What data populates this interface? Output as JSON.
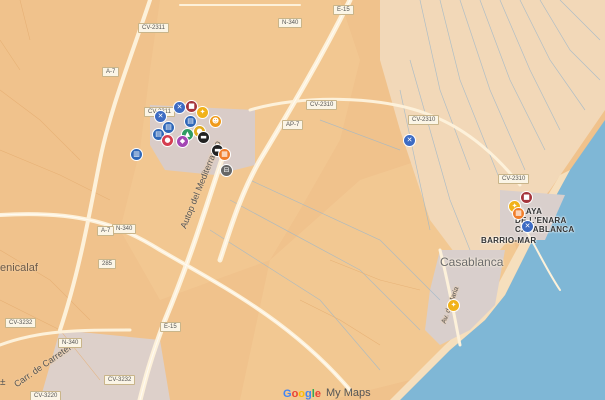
{
  "places": {
    "benicalaf": "enicalaf",
    "casablanca": "Casablanca",
    "barrio_mar": "BARRIO-MAR",
    "playa_lenara_1": "PLAYA",
    "playa_lenara_2": "DE L'ENARA",
    "casablanca_caps": "CASABLANCA"
  },
  "roads": {
    "autopista": "Autop del Mediterraneo",
    "carretera": "Carr. de Carretera",
    "avenida": "Av. de Maria"
  },
  "shields": [
    "CV-2311",
    "N-340",
    "E-15",
    "A-7",
    "CV-2311",
    "AP-7",
    "CV-2310",
    "CV-2310",
    "CV-2310",
    "N-340",
    "A-7",
    "285",
    "E-15",
    "CV-3232",
    "CV-3232",
    "N-340",
    "CV-3220"
  ],
  "markers": [
    {
      "type": "restaurant-icon",
      "color": "#3d6bc3",
      "glyph": "✕"
    },
    {
      "type": "store-icon",
      "color": "#a5343b",
      "glyph": "■"
    },
    {
      "type": "book-icon",
      "color": "#2f67b8",
      "glyph": "▤"
    },
    {
      "type": "restaurant-icon",
      "color": "#3d6bc3",
      "glyph": "✕"
    },
    {
      "type": "hiking-icon",
      "color": "#f1b21a",
      "glyph": "✦"
    },
    {
      "type": "book-icon",
      "color": "#2f67b8",
      "glyph": "▤"
    },
    {
      "type": "book-icon",
      "color": "#2f67b8",
      "glyph": "▤"
    },
    {
      "type": "shop-icon",
      "color": "#d43d4f",
      "glyph": "●"
    },
    {
      "type": "school-icon",
      "color": "#2f9c62",
      "glyph": "▲"
    },
    {
      "type": "pin-icon",
      "color": "#a346b4",
      "glyph": "◆"
    },
    {
      "type": "pin-icon",
      "color": "#e0aa1e",
      "glyph": "●"
    },
    {
      "type": "walk-icon",
      "color": "#f09a1a",
      "glyph": "☻"
    },
    {
      "type": "car-icon",
      "color": "#222222",
      "glyph": "▬"
    },
    {
      "type": "car-icon",
      "color": "#222222",
      "glyph": "▬"
    },
    {
      "type": "store-icon",
      "color": "#f07d2a",
      "glyph": "▦"
    },
    {
      "type": "factory-icon",
      "color": "#2f67b8",
      "glyph": "▥"
    },
    {
      "type": "train-icon",
      "color": "#666666",
      "glyph": "⊟"
    },
    {
      "type": "restaurant-icon",
      "color": "#3d6bc3",
      "glyph": "✕"
    },
    {
      "type": "store-icon",
      "color": "#a5343b",
      "glyph": "■"
    },
    {
      "type": "hiking-icon",
      "color": "#f1b21a",
      "glyph": "✦"
    },
    {
      "type": "shop-icon",
      "color": "#f07d2a",
      "glyph": "▦"
    },
    {
      "type": "restaurant-icon",
      "color": "#3d6bc3",
      "glyph": "✕"
    },
    {
      "type": "hiking-icon",
      "color": "#f1b21a",
      "glyph": "✦"
    }
  ],
  "footer": {
    "google": [
      "G",
      "o",
      "o",
      "g",
      "l",
      "e"
    ],
    "google_colors": [
      "#4285F4",
      "#EA4335",
      "#FBBC05",
      "#4285F4",
      "#34A853",
      "#EA4335"
    ],
    "mymaps": "My Maps"
  },
  "compass": "±",
  "colors": {
    "land": "#f0c28c",
    "water": "#7fb7d6",
    "beach": "#f4d8b0",
    "road": "#fdf2dd",
    "town": "#d6cbc9"
  }
}
